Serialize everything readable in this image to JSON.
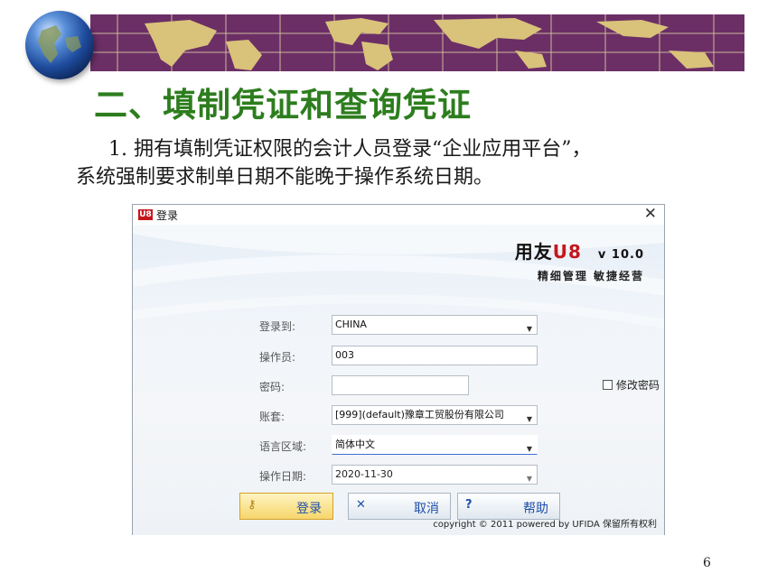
{
  "slide": {
    "title": "二、填制凭证和查询凭证",
    "para_line1": "1. 拥有填制凭证权限的会计人员登录“企业应用平台”，",
    "para_line2": "系统强制要求制单日期不能晚于操作系统日期。",
    "page_number": "6",
    "colors": {
      "band": "#6b2f66",
      "title": "#2d7d1e",
      "map": "#d9c27a"
    }
  },
  "login": {
    "window_title": "登录",
    "app_icon": "U8",
    "brand_main": "用友",
    "brand_u8": "U8",
    "brand_version": "v 10.0",
    "brand_slogan": "精细管理 敏捷经营",
    "fields": {
      "server_label": "登录到:",
      "server_value": "CHINA",
      "operator_label": "操作员:",
      "operator_value": "003",
      "password_label": "密码:",
      "password_value": "",
      "change_password_label": "修改密码",
      "account_label": "账套:",
      "account_value": "[999](default)豫章工贸股份有限公司",
      "language_label": "语言区域:",
      "language_value": "简体中文",
      "date_label": "操作日期:",
      "date_value": "2020-11-30"
    },
    "buttons": {
      "login": "登录",
      "cancel": "取消",
      "help": "帮助"
    },
    "copyright": "copyright © 2011 powered by UFIDA 保留所有权利"
  }
}
